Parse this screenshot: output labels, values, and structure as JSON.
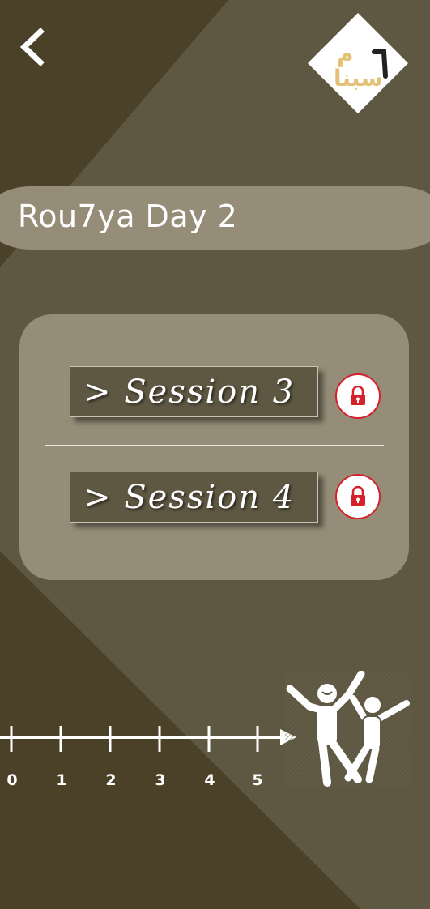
{
  "header": {
    "back_icon": "chevron-left-icon",
    "logo_icon": "logo-icon"
  },
  "title": {
    "text": "Rou7ya Day 2"
  },
  "sessions": [
    {
      "label": "> Session 3",
      "lock_icon": "lock-icon",
      "locked": true
    },
    {
      "label": "> Session 4",
      "lock_icon": "lock-icon",
      "locked": true
    }
  ],
  "timeline": {
    "ticks": [
      "0",
      "1",
      "2",
      "3",
      "4",
      "5"
    ],
    "illustration_icon": "dancing-people-icon"
  },
  "colors": {
    "background": "#5e5843",
    "background_dark": "#4a4128",
    "panel": "#958d77",
    "lock_red": "#d6202a",
    "logo_gold": "#e3c277"
  }
}
